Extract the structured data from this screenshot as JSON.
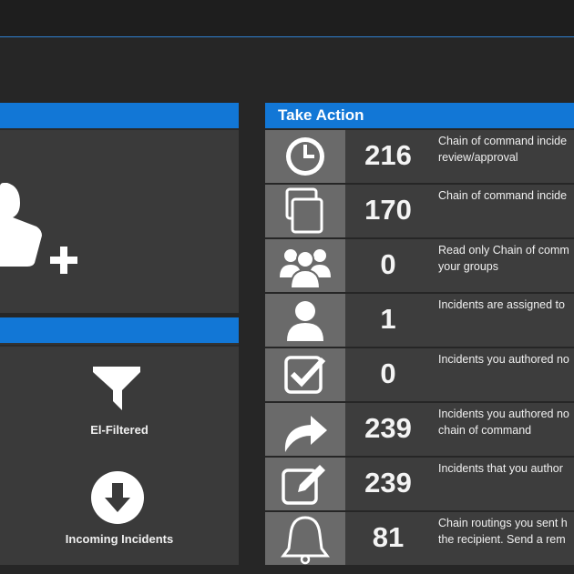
{
  "colors": {
    "accent": "#1277d6",
    "panel": "#3d3d3d",
    "icon_bg": "#6a6a6a",
    "background": "#262626"
  },
  "left_top_panel": {
    "title": "",
    "icon": "user-add-icon"
  },
  "left_bottom_panel": {
    "title": "",
    "tools": [
      {
        "label": "El-Filtered",
        "icon": "filter-icon"
      },
      {
        "label": "Incoming Incidents",
        "icon": "arrow-down-circle-icon"
      }
    ]
  },
  "take_action": {
    "title": "Take Action",
    "rows": [
      {
        "icon": "clock-icon",
        "count": "216",
        "line1": "Chain of command incide",
        "line2": "review/approval"
      },
      {
        "icon": "copy-icon",
        "count": "170",
        "line1": "Chain of command incide",
        "line2": ""
      },
      {
        "icon": "group-icon",
        "count": "0",
        "line1": "Read only Chain of comm",
        "line2": "your groups"
      },
      {
        "icon": "user-icon",
        "count": "1",
        "line1": "Incidents are assigned to",
        "line2": ""
      },
      {
        "icon": "checkbox-icon",
        "count": "0",
        "line1": "Incidents you authored no",
        "line2": ""
      },
      {
        "icon": "share-arrow-icon",
        "count": "239",
        "line1": "Incidents you authored no",
        "line2": "chain of command"
      },
      {
        "icon": "edit-icon",
        "count": "239",
        "line1": "Incidents that you author",
        "line2": ""
      },
      {
        "icon": "bell-icon",
        "count": "81",
        "line1": "Chain routings you sent h",
        "line2": "the recipient. Send a rem"
      }
    ]
  }
}
